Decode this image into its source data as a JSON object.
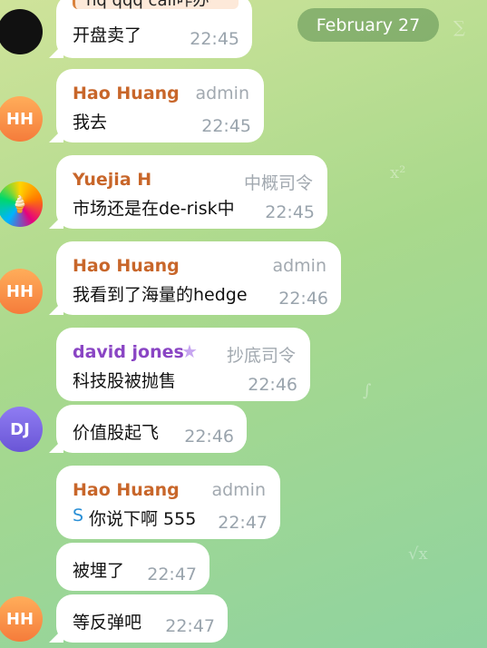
{
  "date_separator": "February 27",
  "messages": [
    {
      "sender": "",
      "text": "开盘卖了",
      "time": "22:45",
      "quote": "nq qqq  call咋办",
      "avatar": "cat"
    },
    {
      "sender": "Hao Huang",
      "tag": "admin",
      "text": "我去",
      "time": "22:45",
      "avatar_initials": "HH"
    },
    {
      "sender": "Yuejia H",
      "tag": "中概司令",
      "text": "市场还是在de-risk中",
      "time": "22:45",
      "avatar": "ice-cream"
    },
    {
      "sender": "Hao Huang",
      "tag": "admin",
      "text": "我看到了海量的hedge",
      "time": "22:46",
      "avatar_initials": "HH"
    },
    {
      "sender": "david jones",
      "tag": "抄底司令",
      "text": "科技股被抛售",
      "time": "22:46"
    },
    {
      "sender": "",
      "text": "价值股起飞",
      "time": "22:46",
      "avatar_initials": "DJ"
    },
    {
      "sender": "Hao Huang",
      "tag": "admin",
      "reply_marker": "S",
      "text": "你说下啊 555",
      "time": "22:47"
    },
    {
      "sender": "",
      "text": "被埋了",
      "time": "22:47"
    },
    {
      "sender": "",
      "text": "等反弹吧",
      "time": "22:47",
      "avatar_initials": "HH"
    }
  ],
  "colors": {
    "sender_orange": "#c8662a",
    "sender_purple": "#8a45c4",
    "timestamp": "#9aa4ad"
  }
}
